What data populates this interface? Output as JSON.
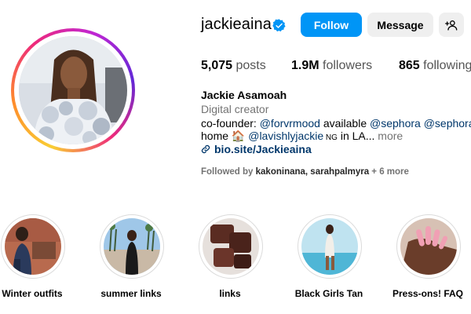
{
  "profile": {
    "username": "jackieaina",
    "verified_icon": "verified-badge-icon",
    "follow_label": "Follow",
    "message_label": "Message",
    "add_user_icon": "person-add-icon",
    "accent_color": "#0095f6"
  },
  "stats": {
    "posts_value": "5,075",
    "posts_label": "posts",
    "followers_value": "1.9M",
    "followers_label": "followers",
    "following_value": "865",
    "following_label": "following"
  },
  "bio": {
    "name": "Jackie Asamoah",
    "category": "Digital creator",
    "line1_prefix": "co-founder: ",
    "mention1": "@forvrmood",
    "line1_mid": " available ",
    "mention2": "@sephora",
    "line1_space": " ",
    "mention3": "@sephoraca",
    "line2_prefix": "home 🏠 ",
    "mention4": "@lavishlyjackie",
    "line2_flag": " NG",
    "line2_suffix": " in LA...",
    "more": " more",
    "link_icon": "link-icon",
    "link_text": "bio.site/Jackieaina"
  },
  "followed_by": {
    "prefix": "Followed by ",
    "names": "kakoninana, sarahpalmyra",
    "suffix": " + 6 more"
  },
  "highlights": [
    {
      "label": "Winter outfits"
    },
    {
      "label": "summer links"
    },
    {
      "label": "links"
    },
    {
      "label": "Black Girls Tan"
    },
    {
      "label": "Press-ons! FAQ"
    }
  ]
}
